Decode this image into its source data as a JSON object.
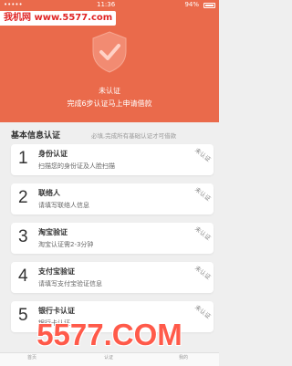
{
  "status_bar": {
    "carrier": "•••••",
    "time": "11:36",
    "battery": "94%"
  },
  "site_banner": "我机网 www.5577.com",
  "header": {
    "status": "未认证",
    "subtitle": "完成6步认证马上申请借款",
    "shield_icon": "shield-check-icon",
    "bg_color": "#ea6a4b"
  },
  "section": {
    "title": "基本信息认证",
    "note": "必填,完成所有基础认证才可借款"
  },
  "steps": [
    {
      "num": "1",
      "title": "身份认证",
      "desc": "扫描您的身份证及人脸扫描",
      "stamp": "未认证"
    },
    {
      "num": "2",
      "title": "联络人",
      "desc": "请填写联络人信息",
      "stamp": "未认证"
    },
    {
      "num": "3",
      "title": "淘宝验证",
      "desc": "淘宝认证需2-3分钟",
      "stamp": "未认证"
    },
    {
      "num": "4",
      "title": "支付宝验证",
      "desc": "请填写支付宝验证信息",
      "stamp": "未认证"
    },
    {
      "num": "5",
      "title": "银行卡认证",
      "desc": "银行卡认证",
      "stamp": "未认证"
    }
  ],
  "watermark": "5577.COM",
  "tabbar": {
    "items": [
      "首页",
      "认证",
      "我的"
    ]
  }
}
